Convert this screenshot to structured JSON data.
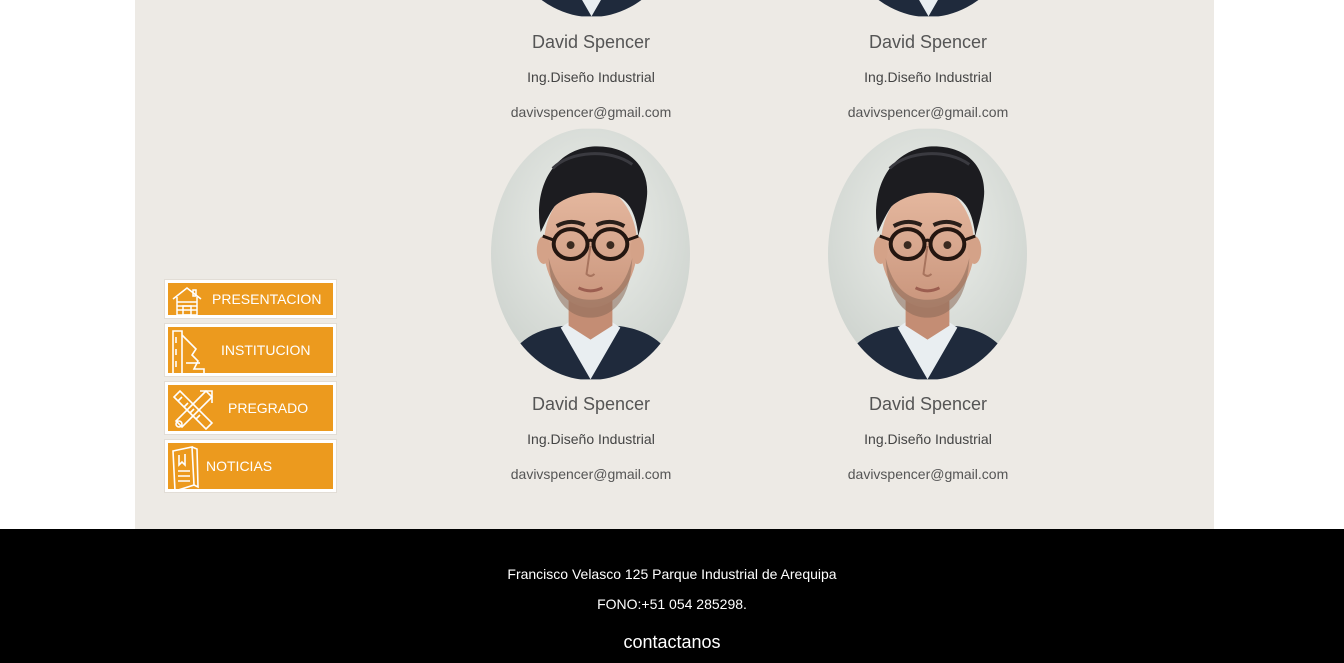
{
  "side_nav": {
    "items": [
      {
        "label": "PRESENTACION",
        "icon": "house-icon"
      },
      {
        "label": "INSTITUCION",
        "icon": "building-icon"
      },
      {
        "label": "PREGRADO",
        "icon": "tools-icon"
      },
      {
        "label": "NOTICIAS",
        "icon": "book-icon"
      }
    ]
  },
  "team": {
    "members": [
      {
        "name": "David Spencer",
        "role": "Ing.Diseño Industrial",
        "email": "davivspencer@gmail.com"
      },
      {
        "name": "David Spencer",
        "role": "Ing.Diseño Industrial",
        "email": "davivspencer@gmail.com"
      },
      {
        "name": "David Spencer",
        "role": "Ing.Diseño Industrial",
        "email": "davivspencer@gmail.com"
      },
      {
        "name": "David Spencer",
        "role": "Ing.Diseño Industrial",
        "email": "davivspencer@gmail.com"
      }
    ]
  },
  "footer": {
    "address": "Francisco Velasco 125 Parque Industrial de Arequipa",
    "phone": "FONO:+51 054 285298.",
    "contact_label": "contactanos"
  },
  "colors": {
    "accent": "#ec9a1e",
    "panel": "#edeae5",
    "footer": "#000000"
  }
}
